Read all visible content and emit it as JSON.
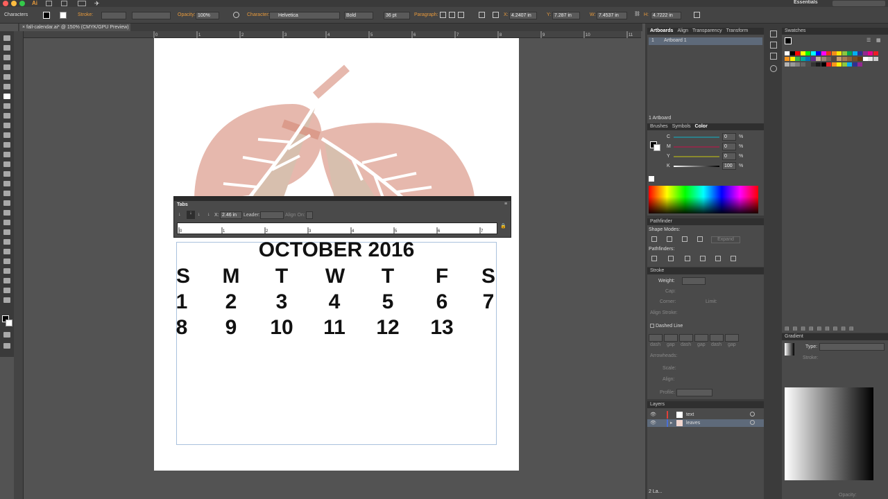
{
  "control_bar": {
    "panel_label": "Characters",
    "stroke_label": "Stroke:",
    "opacity_label": "Opacity:",
    "opacity_value": "100%",
    "character_label": "Character:",
    "font_family": "Helvetica",
    "font_style": "Bold",
    "font_size": "36 pt",
    "paragraph_label": "Paragraph:",
    "x_label": "X:",
    "x_value": "4.2407 in",
    "y_label": "Y:",
    "y_value": "7.287 in",
    "w_label": "W:",
    "w_value": "7.4537 in",
    "h_label": "H:",
    "h_value": "4.7222 in",
    "workspace": "Essentials"
  },
  "document": {
    "tab_title": "fall-calendar.ai* @ 150% (CMYK/GPU Preview)"
  },
  "ruler": {
    "h_ticks": [
      "0",
      "1",
      "2",
      "3",
      "4",
      "5",
      "6",
      "7",
      "8",
      "9",
      "10",
      "11"
    ]
  },
  "tabs_panel": {
    "title": "Tabs",
    "x_label": "X:",
    "x_value": "2.46 in",
    "leader_label": "Leader:",
    "align_on_label": "Align On:",
    "ruler_ticks": [
      "0",
      "1",
      "2",
      "3",
      "4",
      "5",
      "6",
      "7"
    ]
  },
  "calendar": {
    "title": "OCTOBER 2016",
    "days": [
      "S",
      "M",
      "T",
      "W",
      "T",
      "F",
      "S"
    ],
    "week1": [
      "1",
      "2",
      "3",
      "4",
      "5",
      "6",
      "7"
    ],
    "week2": [
      "8",
      "9",
      "10",
      "11",
      "12",
      "13",
      ""
    ]
  },
  "panels": {
    "artboards": {
      "tabs": [
        "Artboards",
        "Align",
        "Transparency",
        "Transform"
      ],
      "row_index": "1",
      "row_name": "Artboard 1",
      "footer": "1 Artboard"
    },
    "color": {
      "tabs": [
        "Brushes",
        "Symbols",
        "Color"
      ],
      "channels": [
        {
          "label": "C",
          "value": "0",
          "unit": "%"
        },
        {
          "label": "M",
          "value": "0",
          "unit": "%"
        },
        {
          "label": "Y",
          "value": "0",
          "unit": "%"
        },
        {
          "label": "K",
          "value": "100",
          "unit": "%"
        }
      ]
    },
    "pathfinder": {
      "title": "Pathfinder",
      "shape_modes": "Shape Modes:",
      "pathfinders": "Pathfinders:",
      "expand": "Expand"
    },
    "stroke": {
      "title": "Stroke",
      "weight": "Weight:",
      "cap": "Cap:",
      "corner": "Corner:",
      "limit": "Limit:",
      "align_stroke": "Align Stroke:",
      "dashed_line": "Dashed Line",
      "dash_labels": [
        "dash",
        "gap",
        "dash",
        "gap",
        "dash",
        "gap"
      ],
      "arrowheads": "Arrowheads:",
      "scale": "Scale:",
      "align": "Align:",
      "profile": "Profile:"
    },
    "layers": {
      "title": "Layers",
      "items": [
        {
          "name": "text",
          "color": "#e0403a"
        },
        {
          "name": "leaves",
          "color": "#4a6fd6"
        }
      ],
      "footer": "2 La..."
    },
    "swatches": {
      "title": "Swatches",
      "colors": [
        "#ffffff",
        "#000000",
        "#ff0000",
        "#ffff00",
        "#00ff00",
        "#00ffff",
        "#0000ff",
        "#ff00ff",
        "#e8311c",
        "#f18d1a",
        "#f6e900",
        "#8dc63f",
        "#00a651",
        "#00aeef",
        "#2e3192",
        "#92278f",
        "#ec008c",
        "#ed1c24",
        "#f7941d",
        "#fff200",
        "#39b54a",
        "#00a99d",
        "#0072bc",
        "#662d91",
        "#c6b299",
        "#998675",
        "#736357",
        "#534741",
        "#c69c6d",
        "#a67c52",
        "#8c6239",
        "#754c24",
        "#603913",
        "#ffffff",
        "#e6e6e6",
        "#cccccc",
        "#b3b3b3",
        "#999999",
        "#808080",
        "#666666",
        "#4d4d4d",
        "#333333",
        "#1a1a1a",
        "#000000",
        "#ed1c24",
        "#f7941d",
        "#fff200",
        "#8dc63f",
        "#00aeef",
        "#2e3192",
        "#92278f"
      ]
    },
    "gradient": {
      "title": "Gradient",
      "type_label": "Type:",
      "stroke_label": "Stroke:",
      "opacity_label": "Opacity:"
    }
  },
  "colors": {
    "leaf_pink": "#e6b8ad",
    "leaf_tan": "#d7bfae",
    "stem": "#d99583",
    "accent_orange": "#e89a3c"
  }
}
